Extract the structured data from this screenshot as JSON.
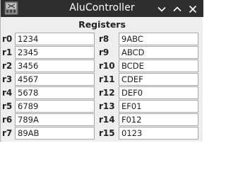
{
  "window": {
    "title": "AluController"
  },
  "panel": {
    "heading": "Registers"
  },
  "registers": [
    {
      "name": "r0",
      "value": "1234"
    },
    {
      "name": "r1",
      "value": "2345"
    },
    {
      "name": "r2",
      "value": "3456"
    },
    {
      "name": "r3",
      "value": "4567"
    },
    {
      "name": "r4",
      "value": "5678"
    },
    {
      "name": "r5",
      "value": "6789"
    },
    {
      "name": "r6",
      "value": "789A"
    },
    {
      "name": "r7",
      "value": "89AB"
    },
    {
      "name": "r8",
      "value": "9ABC"
    },
    {
      "name": "r9",
      "value": "ABCD"
    },
    {
      "name": "r10",
      "value": "BCDE"
    },
    {
      "name": "r11",
      "value": "CDEF"
    },
    {
      "name": "r12",
      "value": "DEF0"
    },
    {
      "name": "r13",
      "value": "EF01"
    },
    {
      "name": "r14",
      "value": "F012"
    },
    {
      "name": "r15",
      "value": "0123"
    }
  ],
  "icons": {
    "app": "app-icon",
    "minimize": "chevron-down-icon",
    "maximize": "chevron-up-icon",
    "close": "close-icon"
  }
}
